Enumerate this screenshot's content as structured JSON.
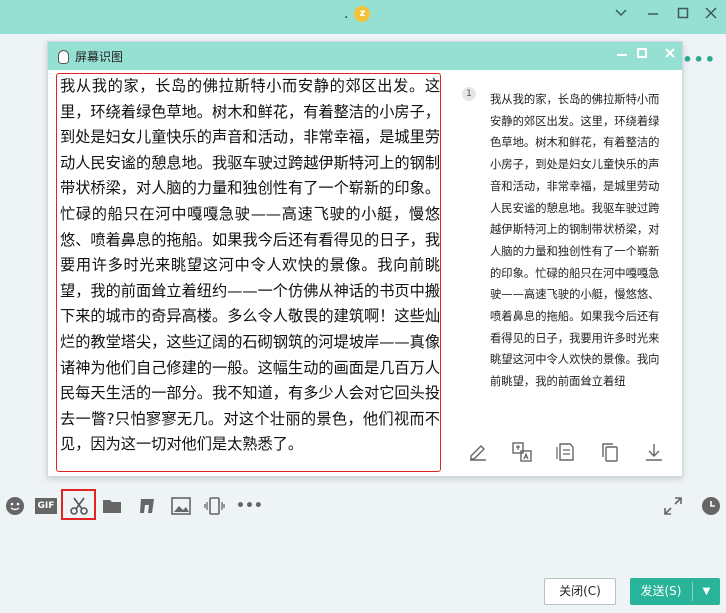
{
  "chat_window": {
    "title_dot": ".",
    "title_badge": "z",
    "minimize_icon": "chevron-down-icon",
    "restore_icon": "minimize-icon",
    "maximize_icon": "maximize-icon",
    "close_icon": "close-icon",
    "more_label": "•••"
  },
  "ocr_window": {
    "title": "屏幕识图",
    "line_number": "1",
    "image_text": "我从我的家，长岛的佛拉斯特小而安静的郊区出发。这里，环绕着绿色草地。树木和鲜花，有着整洁的小房子，到处是妇女儿童快乐的声音和活动，非常幸福，是城里劳动人民安谧的憩息地。我驱车驶过跨越伊斯特河上的钢制带状桥梁，对人脑的力量和独创性有了一个崭新的印象。忙碌的船只在河中嘎嘎急驶——高速飞驶的小艇，慢悠悠、喷着鼻息的拖船。如果我今后还有看得见的日子，我要用许多时光来眺望这河中令人欢快的景像。我向前眺望，我的前面耸立着纽约——一个仿佛从神话的书页中搬下来的城市的奇异高楼。多么令人敬畏的建筑啊！这些灿烂的教堂塔尖，这些辽阔的石砌钢筑的河堤坡岸——真像诸神为他们自己修建的一般。这幅生动的画面是几百万人民每天生活的一部分。我不知道，有多少人会对它回头投去一瞥?只怕寥寥无几。对这个壮丽的景色，他们视而不见，因为这一切对他们是太熟悉了。",
    "result_text": "我从我的家，长岛的佛拉斯特小而安静的郊区出发。这里，环绕着绿色草地。树木和鲜花，有着整洁的小房子，到处是妇女儿童快乐的声音和活动，非常幸福，是城里劳动人民安谧的憩息地。我驱车驶过跨越伊斯特河上的钢制带状桥梁，对人脑的力量和独创性有了一个崭新的印象。忙碌的船只在河中嘎嘎急驶——高速飞驶的小艇，慢悠悠、喷着鼻息的拖船。如果我今后还有看得见的日子，我要用许多时光来眺望这河中令人欢快的景像。我向前眺望，我的前面耸立着纽",
    "actions": [
      "edit-icon",
      "translate-icon",
      "copy-format-icon",
      "copy-icon",
      "download-icon"
    ]
  },
  "toolbar": {
    "icons": [
      "emoji-icon",
      "gif-icon",
      "screenshot-scissors-icon",
      "folder-icon",
      "music-icon",
      "image-icon",
      "shake-window-icon",
      "more-icon"
    ],
    "gif_label": "GIF",
    "more_label": "•••"
  },
  "buttons": {
    "close_label": "关闭(C)",
    "send_label": "发送(S)",
    "send_arrow": "▼"
  },
  "colors": {
    "titlebar": "#96dfd3",
    "accent": "#29b398",
    "highlight_border": "#e02424"
  }
}
